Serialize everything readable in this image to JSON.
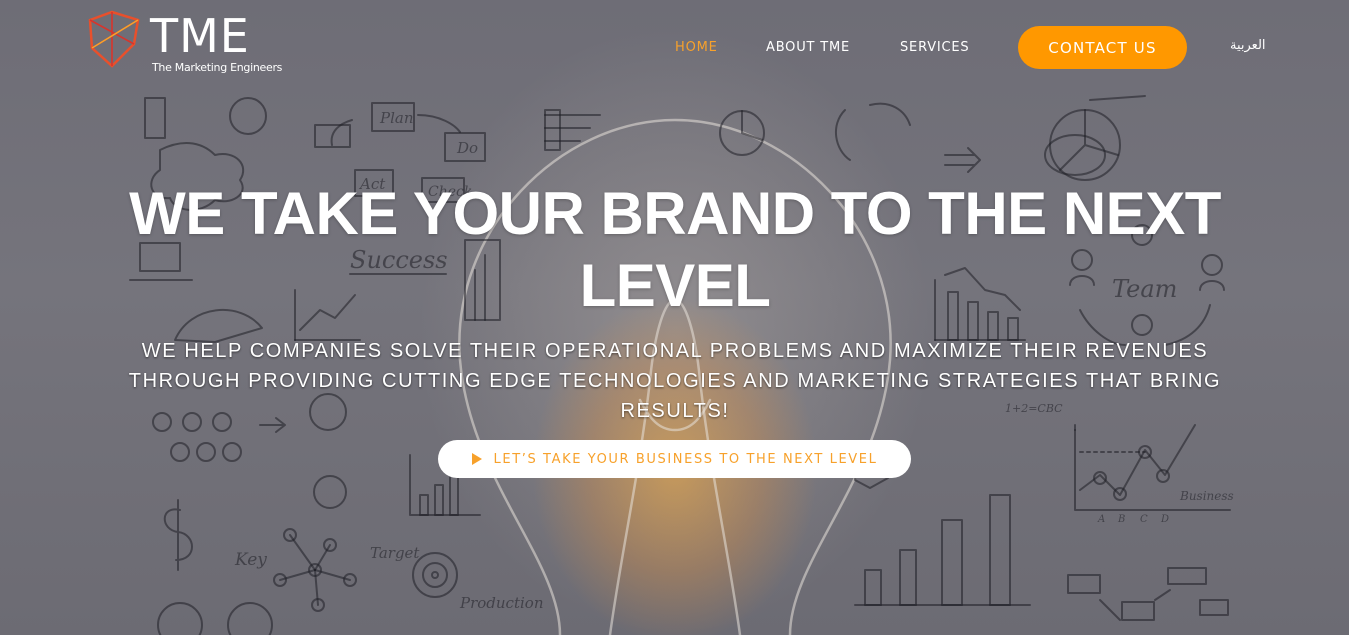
{
  "brand": {
    "name": "TME",
    "tagline": "The Marketing Engineers"
  },
  "nav": {
    "items": [
      {
        "label": "HOME",
        "active": true
      },
      {
        "label": "ABOUT TME",
        "active": false
      },
      {
        "label": "SERVICES",
        "active": false
      }
    ],
    "contact_label": "CONTACT US",
    "language_label": "العربية"
  },
  "hero": {
    "headline": "WE TAKE YOUR BRAND TO THE NEXT LEVEL",
    "subheadline": "WE HELP COMPANIES SOLVE THEIR OPERATIONAL PROBLEMS AND MAXIMIZE THEIR REVENUES THROUGH PROVIDING CUTTING EDGE TECHNOLOGIES AND MARKETING STRATEGIES THAT BRING RESULTS!",
    "cta_label": "LET’S TAKE YOUR BUSINESS TO THE NEXT LEVEL",
    "cta_icon": "play-icon",
    "background_words": [
      "Plan",
      "Do",
      "Act",
      "Check",
      "Success",
      "Team",
      "Key",
      "Target",
      "Production",
      "Business",
      "1+2=CBC",
      "A",
      "B",
      "C",
      "D"
    ]
  },
  "colors": {
    "accent": "#ff9800",
    "nav_active": "#f7a12b",
    "text": "#ffffff",
    "overlay": "#6e6d76"
  }
}
